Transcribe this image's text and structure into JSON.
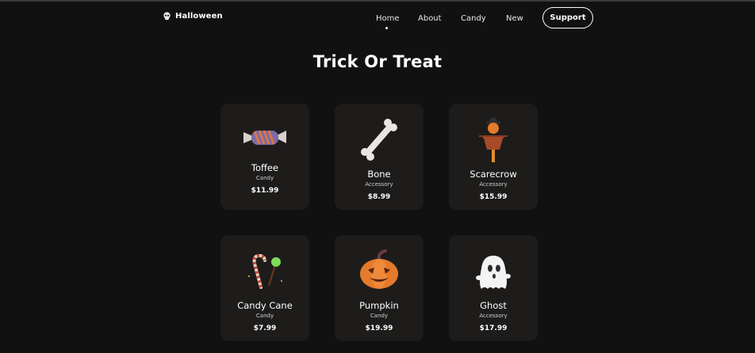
{
  "brand": {
    "name": "Halloween",
    "icon": "skull-icon"
  },
  "nav": {
    "items": [
      "Home",
      "About",
      "Candy",
      "New"
    ],
    "active": "Home",
    "support_label": "Support"
  },
  "section": {
    "title": "Trick Or Treat"
  },
  "products": [
    {
      "name": "Toffee",
      "category": "Candy",
      "price": "$11.99",
      "icon": "toffee-icon"
    },
    {
      "name": "Bone",
      "category": "Accessory",
      "price": "$8.99",
      "icon": "bone-icon"
    },
    {
      "name": "Scarecrow",
      "category": "Accessory",
      "price": "$15.99",
      "icon": "scarecrow-icon"
    },
    {
      "name": "Candy Cane",
      "category": "Candy",
      "price": "$7.99",
      "icon": "candy-cane-icon"
    },
    {
      "name": "Pumpkin",
      "category": "Candy",
      "price": "$19.99",
      "icon": "pumpkin-icon"
    },
    {
      "name": "Ghost",
      "category": "Accessory",
      "price": "$17.99",
      "icon": "ghost-icon"
    }
  ],
  "colors": {
    "background": "#121111",
    "card": "#1d1c1b",
    "text": "#ffffff"
  }
}
